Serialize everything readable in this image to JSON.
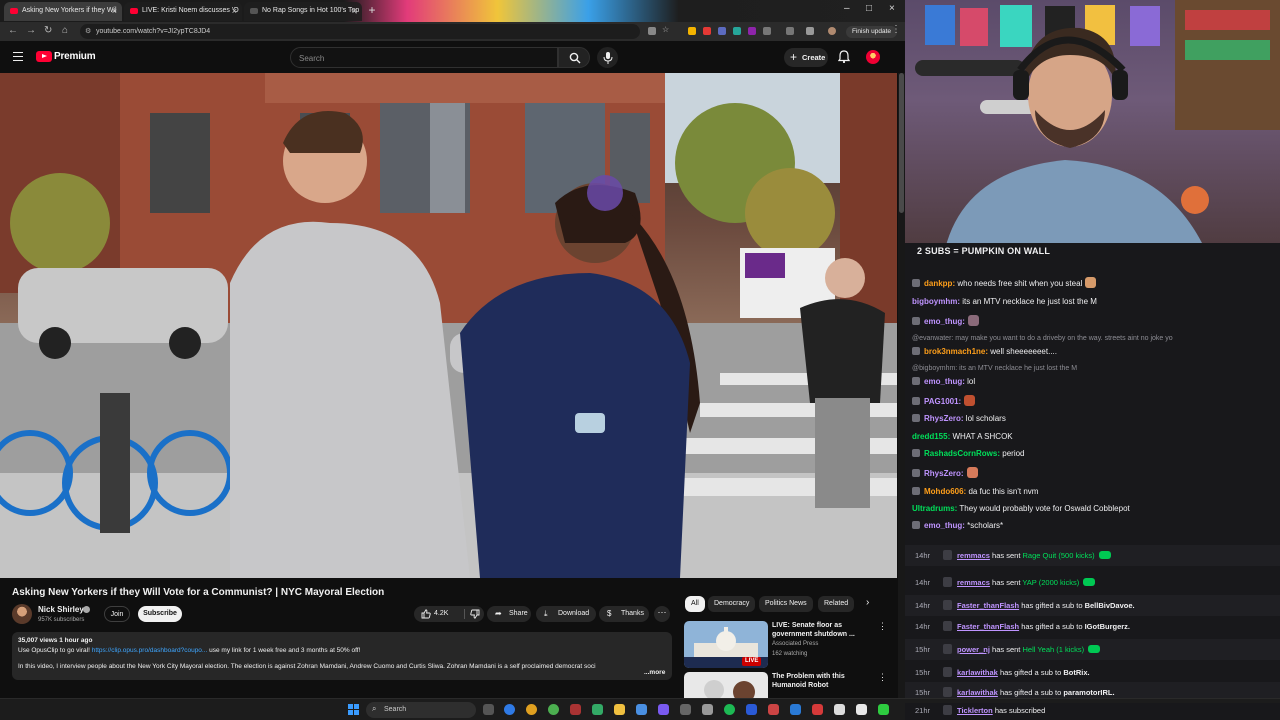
{
  "browser": {
    "tabs": [
      {
        "title": "Asking New Yorkers if they Wil"
      },
      {
        "title": "LIVE: Kristi Noem discusses 'O"
      },
      {
        "title": "No Rap Songs in Hot 100's Top"
      }
    ],
    "url": "youtube.com/watch?v=JI2ypTC8JD4",
    "finish_update": "Finish update"
  },
  "youtube": {
    "brand": "Premium",
    "search_placeholder": "Search",
    "create_label": "Create",
    "video_title": "Asking New Yorkers if they Will Vote for a Communist? | NYC Mayoral Election",
    "channel_name": "Nick Shirley",
    "subscribers": "957K subscribers",
    "join_label": "Join",
    "subscribe_label": "Subscribe",
    "likes": "4.2K",
    "share_label": "Share",
    "download_label": "Download",
    "thanks_label": "Thanks",
    "description": {
      "stats": "35,007 views  1 hour ago",
      "line1_prefix": "Use OpusClip to go viral! ",
      "line1_link": "https://clip.opus.pro/dashboard?coupo...",
      "line1_suffix": " use my link for 1 week free and 3 months at 50% off!",
      "line2": "In this video, I interview people about the New York City Mayoral election. The election is against Zohran Mamdani, Andrew Cuomo and Curtis Sliwa. Zohran Mamdani is a self proclaimed democrat soci",
      "more": "...more"
    },
    "chips": [
      "All",
      "Democracy",
      "Politics News",
      "Related"
    ],
    "recommendations": [
      {
        "title": "LIVE: Senate floor as government shutdown ...",
        "channel": "Associated Press",
        "meta": "162 watching",
        "badge": "LIVE"
      },
      {
        "title": "The Problem with this Humanoid Robot",
        "channel": "",
        "meta": "",
        "badge": ""
      }
    ]
  },
  "chat": {
    "banner": "2 SUBS = PUMPKIN ON WALL",
    "messages": [
      {
        "user": "dankpp:",
        "text": "who needs free shit when you steal",
        "color": "#ff9f1a"
      },
      {
        "user": "bigboymhm:",
        "text": "its an MTV necklace he just lost the M",
        "color": "#bf94ff"
      },
      {
        "user": "emo_thug:",
        "text": "",
        "color": "#bf94ff"
      },
      {
        "reply": "@evanwater: may make you want to do a driveby on the way. streets aint no joke yo"
      },
      {
        "user": "brok3nmach1ne:",
        "text": "well sheeeeeeet....",
        "color": "#ff9f1a"
      },
      {
        "reply": "@bigboymhm: its an MTV necklace he just lost the M"
      },
      {
        "user": "emo_thug:",
        "text": "lol",
        "color": "#bf94ff"
      },
      {
        "user": "PAG1001:",
        "text": "",
        "color": "#bf94ff"
      },
      {
        "user": "RhysZero:",
        "text": "lol scholars",
        "color": "#bf94ff"
      },
      {
        "user": "dredd155:",
        "text": "WHAT A SHCOK",
        "color": "#00e05a"
      },
      {
        "user": "RashadsCornRows:",
        "text": "period",
        "color": "#00e05a"
      },
      {
        "user": "RhysZero:",
        "text": "",
        "color": "#bf94ff"
      },
      {
        "user": "Mohdo606:",
        "text": "da fuc this isn't nvm",
        "color": "#ff9f1a"
      },
      {
        "user": "Ultradrums:",
        "text": "They would probably vote for Oswald Cobblepot",
        "color": "#00e05a"
      },
      {
        "user": "emo_thug:",
        "text": "*scholars*",
        "color": "#bf94ff"
      }
    ],
    "events": [
      {
        "time": "14hr",
        "user": "remmacs",
        "action": "has sent",
        "item": "Rage Quit (500 kicks)",
        "kind": "kicks"
      },
      {
        "time": "14hr",
        "user": "remmacs",
        "action": "has sent",
        "item": "YAP (2000 kicks)",
        "kind": "kicks"
      },
      {
        "time": "14hr",
        "user": "Faster_thanFlash",
        "action": "has gifted a sub to",
        "item": "BellBivDavoe.",
        "kind": "gift"
      },
      {
        "time": "14hr",
        "user": "Faster_thanFlash",
        "action": "has gifted a sub to",
        "item": "IGotBurgerz.",
        "kind": "gift"
      },
      {
        "time": "15hr",
        "user": "power_nj",
        "action": "has sent",
        "item": "Hell Yeah (1 kicks)",
        "kind": "kicks"
      },
      {
        "time": "15hr",
        "user": "karlawithak",
        "action": "has gifted a sub to",
        "item": "BotRix.",
        "kind": "gift"
      },
      {
        "time": "15hr",
        "user": "karlawithak",
        "action": "has gifted a sub to",
        "item": "paramotorIRL.",
        "kind": "gift"
      },
      {
        "time": "21hr",
        "user": "Ticklerton",
        "action": "has subscribed",
        "item": "",
        "kind": "sub"
      }
    ]
  },
  "taskbar": {
    "search_label": "Search"
  },
  "colors": {
    "youtube_red": "#ff0033",
    "chat_bg": "#18181b",
    "kick_green": "#00e05a",
    "link_blue": "#3ea6ff"
  }
}
